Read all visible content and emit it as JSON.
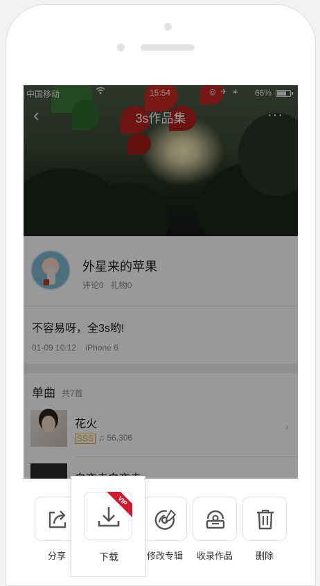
{
  "status_bar": {
    "carrier": "中国移动",
    "time": "15:54",
    "battery": "66%"
  },
  "nav": {
    "back_icon": "‹",
    "title": "3s作品集",
    "more_icon": "···"
  },
  "user": {
    "name": "外星来的苹果",
    "comments": "评论0",
    "gifts": "礼物0"
  },
  "post": {
    "text": "不容易呀，全3s哟!",
    "date": "01-09 10:12",
    "device": "iPhone 6"
  },
  "songs_section": {
    "title": "单曲",
    "count": "共7首",
    "items": [
      {
        "name": "花火",
        "quality": "SSS",
        "plays": "56,306",
        "arrow": "›"
      },
      {
        "name": "白夜走白夜走"
      }
    ]
  },
  "actions": [
    {
      "label": "分享",
      "icon": "share-icon"
    },
    {
      "label": "下载",
      "icon": "download-icon",
      "badge": "VIP"
    },
    {
      "label": "修改专辑",
      "icon": "edit-album-icon"
    },
    {
      "label": "收录作品",
      "icon": "collect-icon"
    },
    {
      "label": "删除",
      "icon": "trash-icon"
    }
  ],
  "colors": {
    "accent_red": "#d0182f",
    "quality_gold": "#e0a21a"
  }
}
